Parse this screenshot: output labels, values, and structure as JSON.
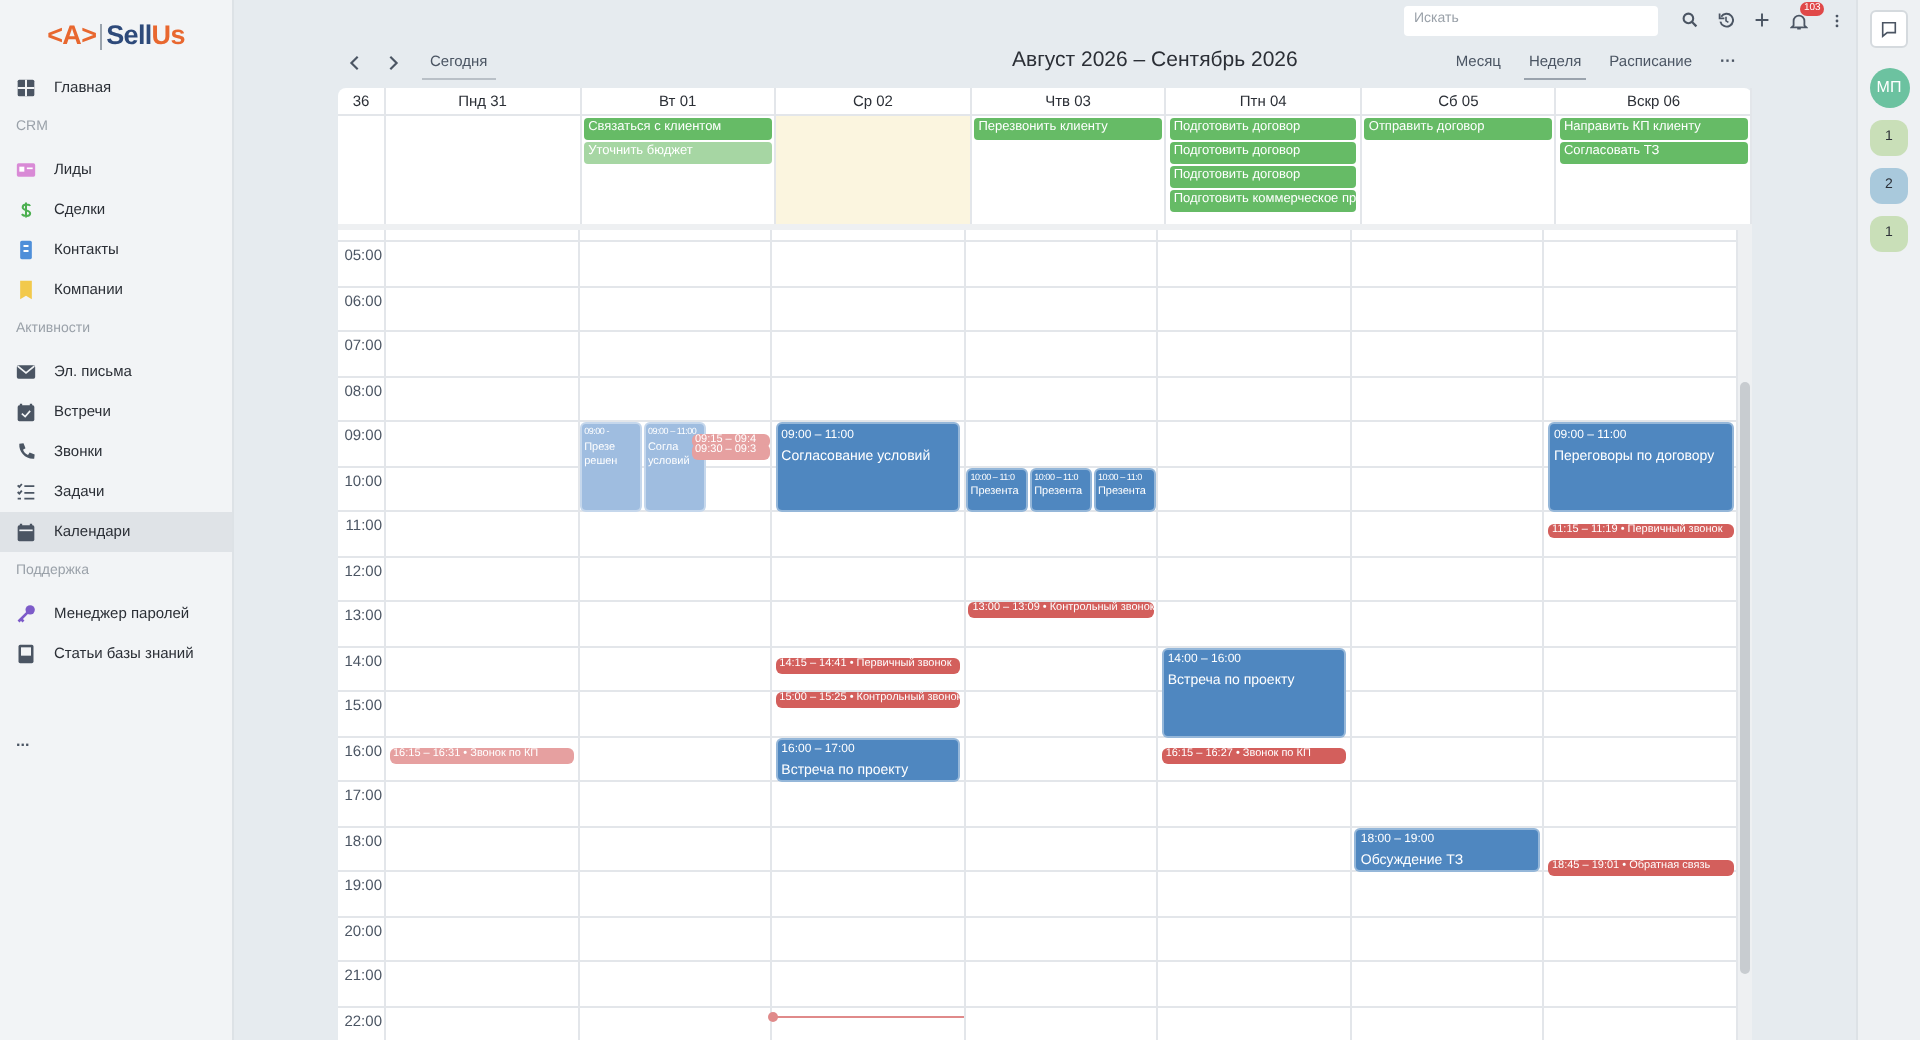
{
  "logo": {
    "mark": "<A>",
    "name_a": "Sell",
    "name_b": "Us"
  },
  "sidebar": [
    {
      "kind": "item",
      "label": "Главная",
      "selected": false
    },
    {
      "kind": "section",
      "label": "CRM"
    },
    {
      "kind": "item",
      "label": "Лиды",
      "selected": false
    },
    {
      "kind": "item",
      "label": "Сделки",
      "selected": false
    },
    {
      "kind": "item",
      "label": "Контакты",
      "selected": false
    },
    {
      "kind": "item",
      "label": "Компании",
      "selected": false
    },
    {
      "kind": "section",
      "label": "Активности"
    },
    {
      "kind": "item",
      "label": "Эл. письма",
      "selected": false
    },
    {
      "kind": "item",
      "label": "Встречи",
      "selected": false
    },
    {
      "kind": "item",
      "label": "Звонки",
      "selected": false
    },
    {
      "kind": "item",
      "label": "Задачи",
      "selected": false
    },
    {
      "kind": "item",
      "label": "Календари",
      "selected": true
    },
    {
      "kind": "section",
      "label": "Поддержка"
    },
    {
      "kind": "item",
      "label": "Менеджер паролей",
      "selected": false
    },
    {
      "kind": "item",
      "label": "Статьи базы знаний",
      "selected": false
    }
  ],
  "sidebar_more": "...",
  "topbar": {
    "search_placeholder": "Искать",
    "notifications": "103"
  },
  "toolbar": {
    "today": "Сегодня",
    "title": "Август 2026 – Сентябрь 2026",
    "more": "···",
    "views": [
      {
        "label": "Месяц",
        "selected": false
      },
      {
        "label": "Неделя",
        "selected": true
      },
      {
        "label": "Расписание",
        "selected": false
      }
    ]
  },
  "week_number": "36",
  "hours": [
    "05:00",
    "06:00",
    "07:00",
    "08:00",
    "09:00",
    "10:00",
    "11:00",
    "12:00",
    "13:00",
    "14:00",
    "15:00",
    "16:00",
    "17:00",
    "18:00",
    "19:00",
    "20:00",
    "21:00",
    "22:00"
  ],
  "days": [
    {
      "label": "Пнд 31",
      "today": false,
      "events": [
        {
          "kind": "call",
          "text": "16:15 – 16:31 • Звонок по КП",
          "past": true
        }
      ]
    },
    {
      "label": "Вт 01",
      "today": false,
      "all_day": [
        {
          "title": "Связаться с клиентом",
          "past": false
        },
        {
          "title": "Уточнить бюджет",
          "past": true
        }
      ],
      "events": [
        {
          "kind": "meeting",
          "time": "09:00 -",
          "title": "Презе решен",
          "past": true
        },
        {
          "kind": "meeting",
          "time": "09:00 – 11:00",
          "title": "Согла условий",
          "past": true
        },
        {
          "kind": "call",
          "text": "09:15 – 09:4",
          "past": true
        },
        {
          "kind": "call",
          "text": "09:30 – 09:3",
          "past": true
        }
      ]
    },
    {
      "label": "Ср 02",
      "today": true,
      "events": [
        {
          "kind": "meeting",
          "time": "09:00 – 11:00",
          "title": "Согласование условий",
          "past": false
        },
        {
          "kind": "call",
          "text": "14:15 – 14:41 • Первичный звонок",
          "past": false
        },
        {
          "kind": "call",
          "text": "15:00 – 15:25 • Контрольный звонок",
          "past": false
        },
        {
          "kind": "meeting",
          "time": "16:00 – 17:00",
          "title": "Встреча по проекту",
          "past": false
        }
      ]
    },
    {
      "label": "Чтв 03",
      "today": false,
      "all_day": [
        {
          "title": "Перезвонить клиенту",
          "past": false
        }
      ],
      "events": [
        {
          "kind": "meeting",
          "time": "10:00 – 11:0",
          "title": "Презента",
          "past": false
        },
        {
          "kind": "meeting",
          "time": "10:00 – 11:0",
          "title": "Презента",
          "past": false
        },
        {
          "kind": "meeting",
          "time": "10:00 – 11:0",
          "title": "Презента",
          "past": false
        },
        {
          "kind": "call",
          "text": "13:00 – 13:09 • Контрольный звонок",
          "past": false
        }
      ]
    },
    {
      "label": "Птн 04",
      "today": false,
      "all_day": [
        {
          "title": "Подготовить договор",
          "past": false
        },
        {
          "title": "Подготовить договор",
          "past": false
        },
        {
          "title": "Подготовить договор",
          "past": false
        },
        {
          "title": "Подготовить коммерческое пр",
          "past": false
        }
      ],
      "events": [
        {
          "kind": "meeting",
          "time": "14:00 – 16:00",
          "title": "Встреча по проекту",
          "past": false
        },
        {
          "kind": "call",
          "text": "16:15 – 16:27 • Звонок по КП",
          "past": false
        }
      ]
    },
    {
      "label": "Сб 05",
      "today": false,
      "all_day": [
        {
          "title": "Отправить договор",
          "past": false
        }
      ],
      "events": [
        {
          "kind": "meeting",
          "time": "18:00 – 19:00",
          "title": "Обсуждение ТЗ",
          "past": false
        }
      ]
    },
    {
      "label": "Вскр 06",
      "today": false,
      "all_day": [
        {
          "title": "Направить КП клиенту",
          "past": false
        },
        {
          "title": "Согласовать ТЗ",
          "past": false
        }
      ],
      "events": [
        {
          "kind": "meeting",
          "time": "09:00 – 11:00",
          "title": "Переговоры по договору",
          "past": false
        },
        {
          "kind": "call",
          "text": "11:15 – 11:19 • Первичный звонок",
          "past": false
        },
        {
          "kind": "call",
          "text": "18:45 – 19:01 • Обратная связь",
          "past": false
        }
      ]
    }
  ],
  "right_panel": {
    "avatar": "МП",
    "counters": [
      {
        "count": "1",
        "color": "#c9dfb8"
      },
      {
        "count": "2",
        "color": "#a9c9dc"
      },
      {
        "count": "1",
        "color": "#c9dfb8"
      }
    ]
  }
}
